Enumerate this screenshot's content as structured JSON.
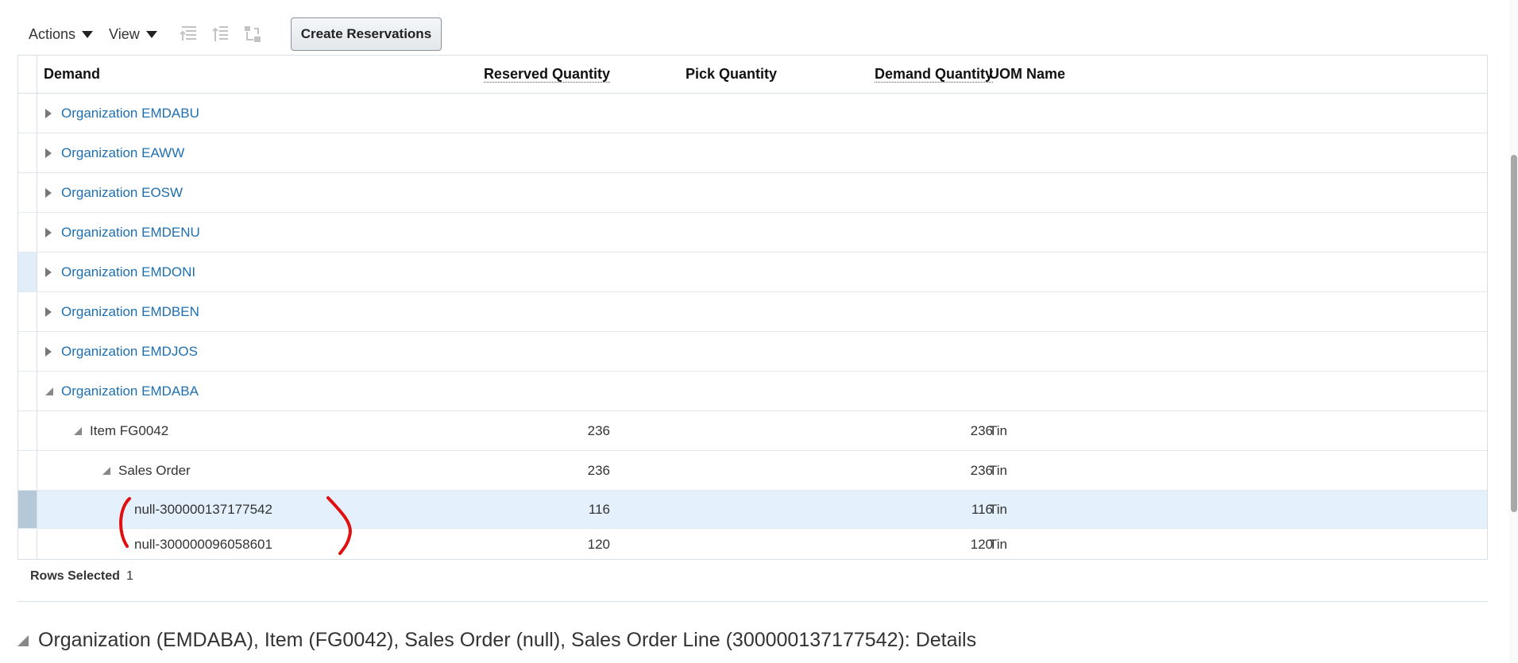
{
  "toolbar": {
    "actions": "Actions",
    "view": "View",
    "create_reservations": "Create Reservations"
  },
  "columns": {
    "demand": "Demand",
    "reserved": "Reserved Quantity",
    "pick": "Pick Quantity",
    "demand_qty": "Demand Quantity",
    "uom": "UOM Name"
  },
  "rows": [
    {
      "label": "Organization EMDABU"
    },
    {
      "label": "Organization EAWW"
    },
    {
      "label": "Organization EOSW"
    },
    {
      "label": "Organization EMDENU"
    },
    {
      "label": "Organization EMDONI"
    },
    {
      "label": "Organization EMDBEN"
    },
    {
      "label": "Organization EMDJOS"
    },
    {
      "label": "Organization EMDABA"
    },
    {
      "label": "Item FG0042",
      "reserved": "236",
      "demand_qty": "236",
      "uom": "Tin"
    },
    {
      "label": "Sales Order",
      "reserved": "236",
      "demand_qty": "236",
      "uom": "Tin"
    },
    {
      "label": "null-300000137177542",
      "reserved": "116",
      "demand_qty": "116",
      "uom": "Tin"
    },
    {
      "label": "null-300000096058601",
      "reserved": "120",
      "demand_qty": "120",
      "uom": "Tin"
    }
  ],
  "footer": {
    "rows_selected_label": "Rows Selected",
    "rows_selected_value": "1"
  },
  "details_title": "Organization (EMDABA), Item (FG0042), Sales Order (null), Sales Order Line (300000137177542): Details",
  "colors": {
    "link": "#1e6fb0",
    "selected_row": "#e4f0fb",
    "annotation": "#e01010"
  }
}
